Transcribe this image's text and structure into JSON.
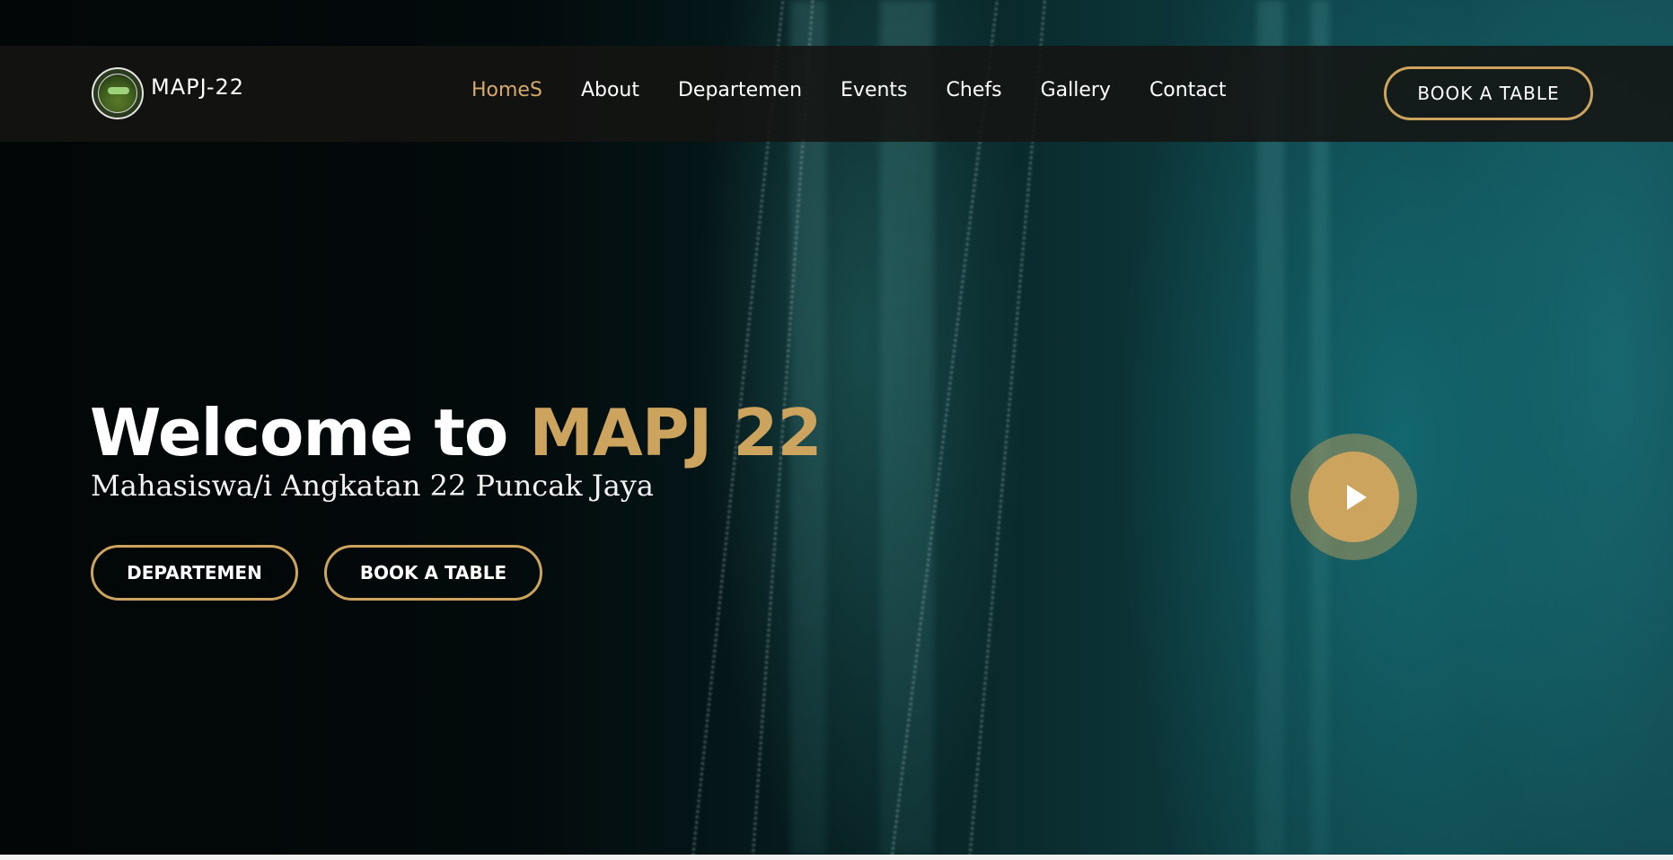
{
  "brand": {
    "name": "MAPJ-22",
    "logo_icon": "mapj-logo-icon"
  },
  "nav": {
    "items": [
      {
        "label": "HomeS",
        "active": true
      },
      {
        "label": "About",
        "active": false
      },
      {
        "label": "Departemen",
        "active": false
      },
      {
        "label": "Events",
        "active": false
      },
      {
        "label": "Chefs",
        "active": false
      },
      {
        "label": "Gallery",
        "active": false
      },
      {
        "label": "Contact",
        "active": false
      }
    ],
    "cta_label": "BOOK A TABLE"
  },
  "hero": {
    "title_prefix": "Welcome to ",
    "title_accent": "MAPJ 22",
    "subtitle": "Mahasiswa/i Angkatan 22 Puncak Jaya",
    "primary_button": "DEPARTEMEN",
    "secondary_button": "BOOK A TABLE",
    "play_icon": "play-icon"
  },
  "colors": {
    "accent": "#cda45e",
    "nav_active": "#d6aa6a",
    "header_bg": "#141412",
    "text": "#ffffff"
  }
}
